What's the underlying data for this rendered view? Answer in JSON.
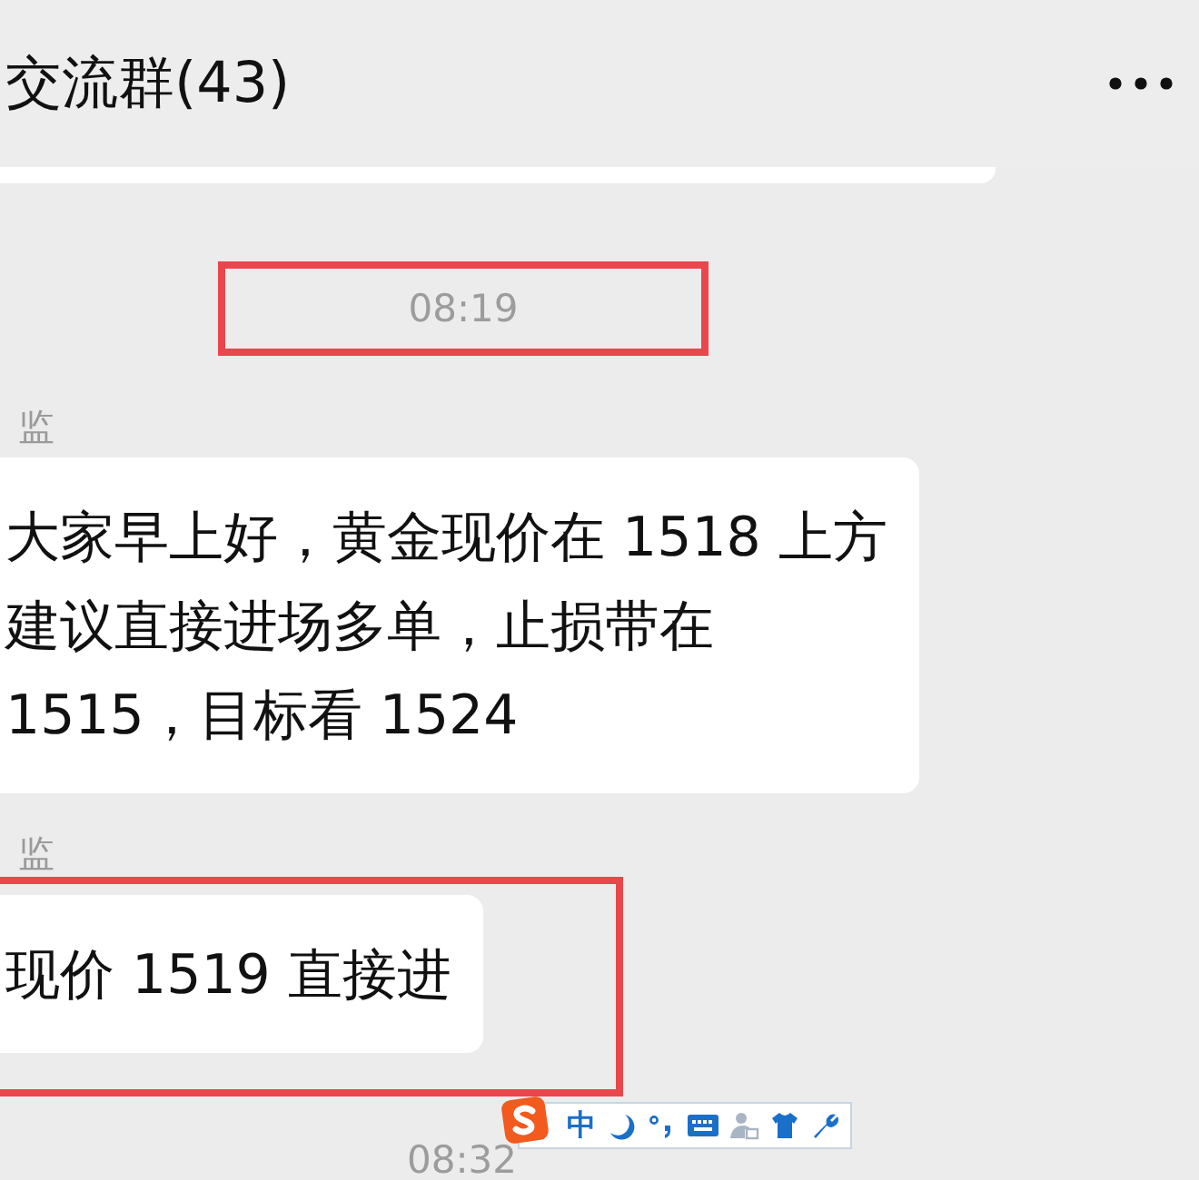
{
  "header": {
    "title": "交流群(43)"
  },
  "items": [
    {
      "kind": "bubble_end"
    },
    {
      "kind": "time",
      "text": "08:19",
      "highlighted": true
    },
    {
      "kind": "message",
      "sender": "监",
      "lines": [
        "大家早上好，黄金现价在 1518 上方",
        "建议直接进场多单，止损带在",
        "1515，目标看 1524"
      ],
      "highlighted": false
    },
    {
      "kind": "message",
      "sender": "监",
      "lines": [
        "现价 1519 直接进"
      ],
      "highlighted": true
    },
    {
      "kind": "time",
      "text": "08:32",
      "highlighted": false
    }
  ],
  "ime_toolbar": {
    "mode": "中"
  }
}
